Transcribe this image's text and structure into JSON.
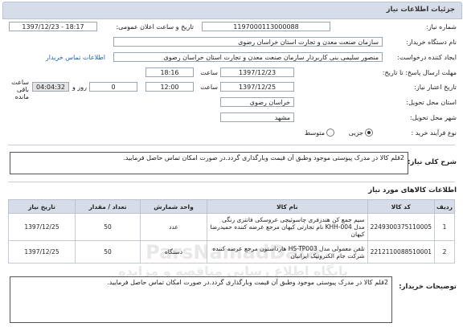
{
  "header": {
    "title": "جزئیات اطلاعات نیاز"
  },
  "form": {
    "need_number_label": "شماره نیاز:",
    "need_number": "1197000113000088",
    "announce_label": "تاریخ و ساعت اعلان عمومی:",
    "announce_value": "1397/12/23 - 18:17",
    "buyer_org_label": "نام دستگاه خریدار:",
    "buyer_org": "سازمان صنعت معدن و تجارت استان خراسان رضوی",
    "creator_label": "ایجاد کننده درخواست:",
    "creator": "منصور سلیمی بنی کاربردار سازمان صنعت معدن و تجارت استان خراسان رضوی",
    "contact_link": "اطلاعات تماس خریدار",
    "send_deadline_label": "مهلت ارسال پاسخ: تا تاریخ:",
    "send_date": "1397/12/23",
    "time_label": "ساعت",
    "send_time": "18:16",
    "validity_label": "تاریخ اعتبار نیاز:",
    "validity_date": "1397/12/25",
    "validity_time": "12:00",
    "days_value": "0",
    "day_and_label": "روز و",
    "remaining_time": "04:04:32",
    "remaining_label": "ساعت باقی مانده",
    "province_label": "استان محل تحویل:",
    "province": "خراسان رضوی",
    "city_label": "شهر محل تحویل:",
    "city": "مشهد",
    "purchase_type_label": "نوع فرآیند خرید :",
    "purchase_type_options": [
      "جزیی",
      "متوسط"
    ],
    "purchase_type_selected": "جزیی"
  },
  "summary": {
    "label": "شرح کلی نیاز:",
    "text": "2قلم کالا در مدرک پیوستی موجود وطبق آن قیمت وبارگذاری گردد.در صورت امکان تماس حاصل فرمایید."
  },
  "goods": {
    "section_title": "اطلاعات کالاهای مورد نیاز",
    "columns": [
      "ردیف",
      "کد کالا",
      "نام کالا",
      "واحد شمارش",
      "تعداد / مقدار",
      "تاریخ نیاز"
    ],
    "rows": [
      {
        "row": "1",
        "code": "2249300375110005",
        "name": "سیم جمع کن هندزفری چاسوئیچی عروسکی فانتزی رنگی مدل KHH-004 نام تجارتی کیهان مرجع عرضه کننده حمیدرضا کیهان",
        "unit": "عدد",
        "qty": "50",
        "date": "1397/12/25"
      },
      {
        "row": "2",
        "code": "2212110088510001",
        "name": "تلفن معمولی مدل HS-TP003 هارداستون مرجع عرضه کننده شرکت جام الکترونیک ایرانیان",
        "unit": "دستگاه",
        "qty": "50",
        "date": "1397/12/25"
      }
    ]
  },
  "buyer_notes": {
    "label": "توضیحات خریدار:",
    "text": "2قلم کالا در مدرک پیوستی موجود وطبق آن قیمت وبارگذاری گردد.در صورت امکان تماس حاصل فرمایید."
  },
  "watermark": {
    "line1": "ParsNamadData",
    "line2": "پایگاه اطلاع رسانی مناقصه و مزایده"
  }
}
